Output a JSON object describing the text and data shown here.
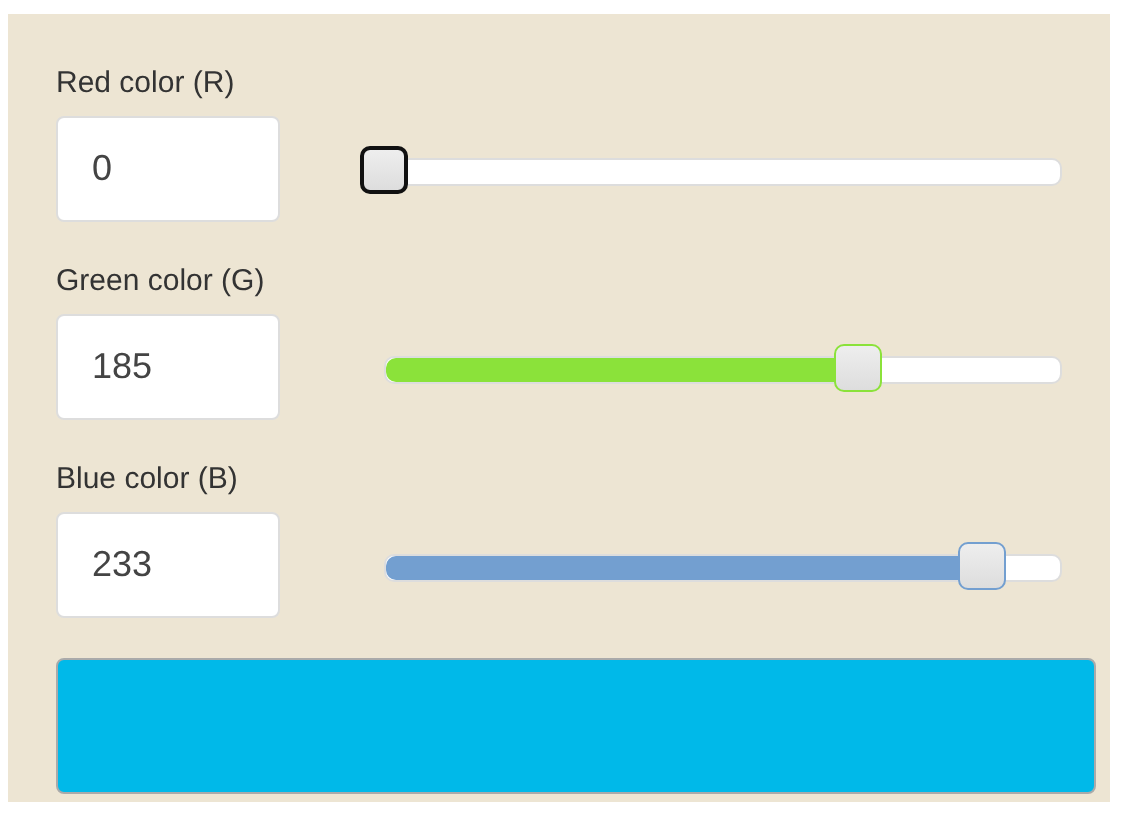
{
  "channels": [
    {
      "label": "Red color (R)",
      "value": "0",
      "level": 0,
      "focused": true
    },
    {
      "label": "Green color (G)",
      "value": "185",
      "level": 0.725,
      "focused": false,
      "color": "#8be23a"
    },
    {
      "label": "Blue color (B)",
      "value": "233",
      "level": 0.914,
      "focused": false,
      "color": "#739fd0"
    }
  ],
  "preview": {
    "color": "#00b9e9"
  }
}
